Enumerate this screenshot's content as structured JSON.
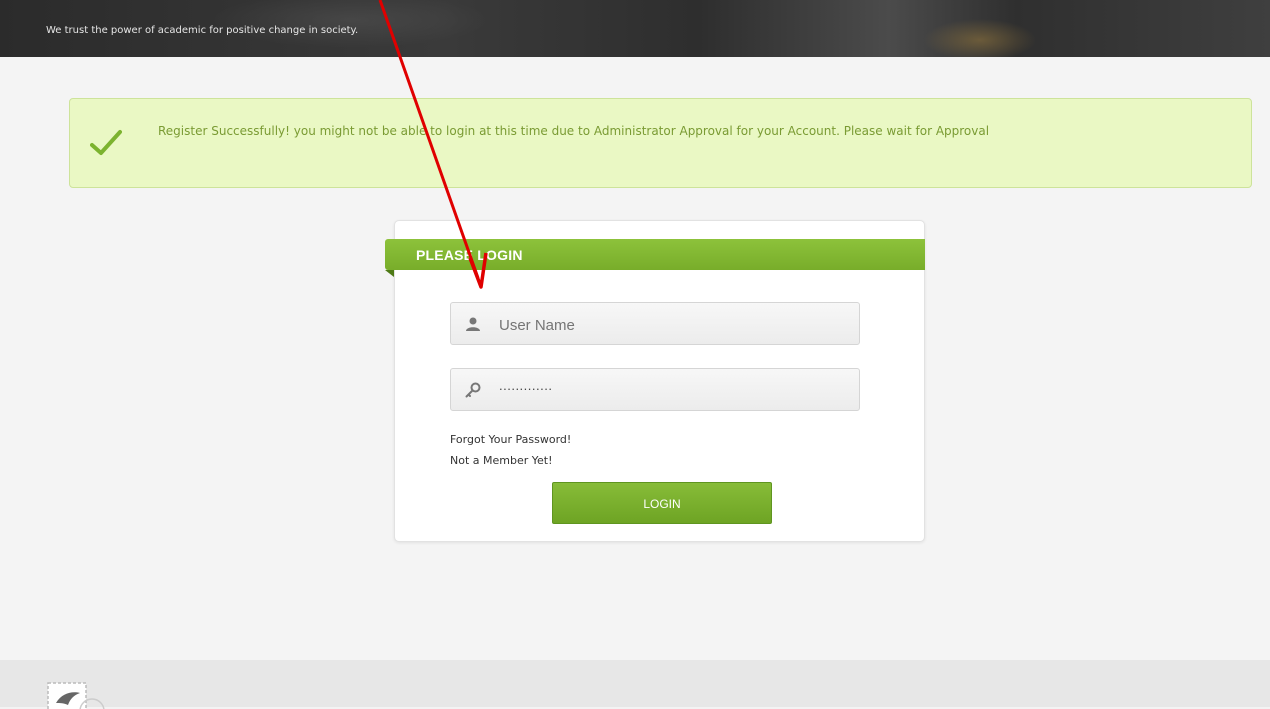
{
  "header": {
    "tagline": "We trust the power of academic for positive change in society."
  },
  "alert": {
    "icon": "checkmark-icon",
    "message": "Register Successfully! you might not be able to login at this time due to Administrator Approval for your Account. Please wait for Approval"
  },
  "login": {
    "title": "PLEASE LOGIN",
    "username_placeholder": "User Name",
    "username_icon": "user-icon",
    "password_value": ".............",
    "password_icon": "key-icon",
    "forgot_link": "Forgot Your Password!",
    "member_link": "Not a Member Yet!",
    "button_label": "LOGIN"
  },
  "colors": {
    "accent_green": "#7cb32f",
    "alert_bg": "#eaf8c4",
    "alert_text": "#7a9b33",
    "annotation_arrow": "#e00000"
  },
  "footer": {
    "logo_icon": "bird-stamp-icon"
  }
}
